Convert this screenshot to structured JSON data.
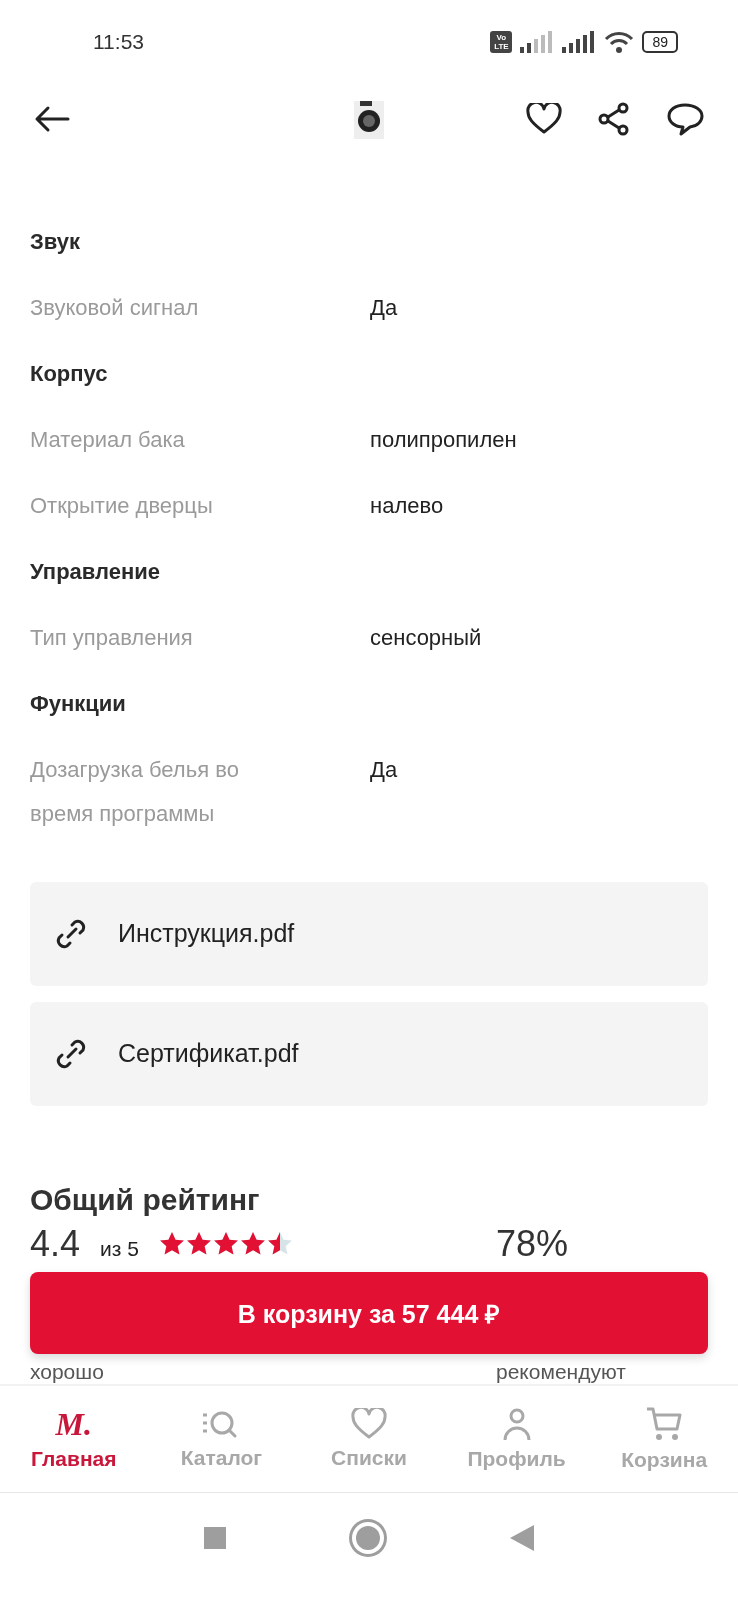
{
  "status_bar": {
    "time": "11:53",
    "volte": "Vo LTE",
    "battery": "89"
  },
  "specs": [
    {
      "kind": "heading",
      "label": "Звук"
    },
    {
      "kind": "row",
      "label": "Звуковой сигнал",
      "value": "Да"
    },
    {
      "kind": "heading",
      "label": "Корпус"
    },
    {
      "kind": "row",
      "label": "Материал бака",
      "value": "полипропилен"
    },
    {
      "kind": "row",
      "label": "Открытие дверцы",
      "value": "налево"
    },
    {
      "kind": "heading",
      "label": "Управление"
    },
    {
      "kind": "row",
      "label": "Тип управления",
      "value": "сенсорный"
    },
    {
      "kind": "heading",
      "label": "Функции"
    },
    {
      "kind": "row",
      "label": "Дозагрузка белья во время программы",
      "value": "Да"
    }
  ],
  "documents": [
    "Инструкция.pdf",
    "Сертификат.pdf"
  ],
  "rating": {
    "title": "Общий рейтинг",
    "score": "4.4",
    "out_of": "из 5",
    "stars": 4.5,
    "verdict": "хорошо",
    "percent": "78%",
    "percent_label": "рекомендуют"
  },
  "cart_button": "В корзину за 57 444 ₽",
  "nav": [
    {
      "kind": "logo",
      "glyph": "М.",
      "label": "Главная",
      "selected": true
    },
    {
      "kind": "catalog",
      "label": "Каталог",
      "selected": false
    },
    {
      "kind": "lists",
      "label": "Списки",
      "selected": false
    },
    {
      "kind": "profile",
      "label": "Профиль",
      "selected": false
    },
    {
      "kind": "cart",
      "label": "Корзина",
      "selected": false
    }
  ]
}
